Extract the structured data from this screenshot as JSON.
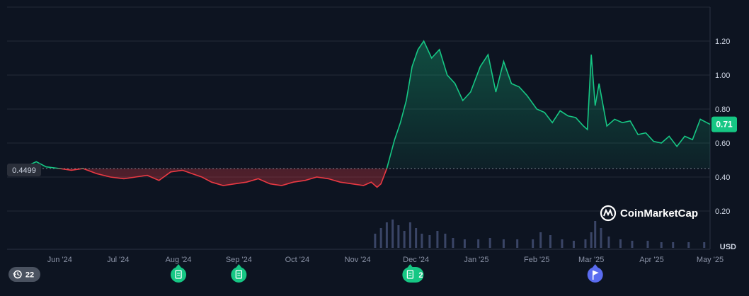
{
  "chart_data": {
    "type": "area",
    "baseline": 0.4499,
    "current_value": 0.71,
    "currency": "USD",
    "ylim": [
      0.0,
      1.38
    ],
    "y_ticks": [
      0.2,
      0.4,
      0.6,
      0.8,
      1.0,
      1.2
    ],
    "y_tick_labels": [
      "0.20",
      "0.40",
      "0.60",
      "0.80",
      "1.00",
      "1.20"
    ],
    "baseline_label": "0.4499",
    "current_label": "0.71",
    "x_ticks": [
      {
        "label": "Jun '24",
        "date": "2024-06-01"
      },
      {
        "label": "Jul '24",
        "date": "2024-07-01"
      },
      {
        "label": "Aug '24",
        "date": "2024-08-01"
      },
      {
        "label": "Sep '24",
        "date": "2024-09-01"
      },
      {
        "label": "Oct '24",
        "date": "2024-10-01"
      },
      {
        "label": "Nov '24",
        "date": "2024-11-01"
      },
      {
        "label": "Dec '24",
        "date": "2024-12-01"
      },
      {
        "label": "Jan '25",
        "date": "2025-01-01"
      },
      {
        "label": "Feb '25",
        "date": "2025-02-01"
      },
      {
        "label": "Mar '25",
        "date": "2025-03-01"
      },
      {
        "label": "Apr '25",
        "date": "2025-04-01"
      },
      {
        "label": "May '25",
        "date": "2025-05-01"
      }
    ],
    "x_range": [
      "2024-05-05",
      "2025-05-01"
    ],
    "series": [
      {
        "x": [
          "2024-05-05",
          "2024-05-12",
          "2024-05-16",
          "2024-05-20",
          "2024-05-25",
          "2024-06-01",
          "2024-06-07",
          "2024-06-13",
          "2024-06-20",
          "2024-06-27",
          "2024-07-04",
          "2024-07-10",
          "2024-07-16",
          "2024-07-22",
          "2024-07-28",
          "2024-08-03",
          "2024-08-08",
          "2024-08-13",
          "2024-08-18",
          "2024-08-24",
          "2024-08-30",
          "2024-09-05",
          "2024-09-11",
          "2024-09-17",
          "2024-09-23",
          "2024-09-29",
          "2024-10-05",
          "2024-10-11",
          "2024-10-17",
          "2024-10-23",
          "2024-10-29",
          "2024-11-04",
          "2024-11-08",
          "2024-11-11",
          "2024-11-13",
          "2024-11-16",
          "2024-11-20",
          "2024-11-23",
          "2024-11-26",
          "2024-11-29",
          "2024-12-02",
          "2024-12-05",
          "2024-12-09",
          "2024-12-13",
          "2024-12-17",
          "2024-12-21",
          "2024-12-25",
          "2024-12-29",
          "2025-01-03",
          "2025-01-07",
          "2025-01-11",
          "2025-01-15",
          "2025-01-19",
          "2025-01-23",
          "2025-01-27",
          "2025-02-01",
          "2025-02-05",
          "2025-02-09",
          "2025-02-13",
          "2025-02-17",
          "2025-02-21",
          "2025-02-25",
          "2025-02-27",
          "2025-03-01",
          "2025-03-03",
          "2025-03-05",
          "2025-03-09",
          "2025-03-13",
          "2025-03-17",
          "2025-03-21",
          "2025-03-25",
          "2025-03-29",
          "2025-04-02",
          "2025-04-06",
          "2025-04-10",
          "2025-04-14",
          "2025-04-18",
          "2025-04-22",
          "2025-04-26",
          "2025-05-01"
        ],
        "y": [
          0.45,
          0.46,
          0.47,
          0.49,
          0.46,
          0.45,
          0.44,
          0.45,
          0.42,
          0.4,
          0.39,
          0.4,
          0.41,
          0.38,
          0.43,
          0.44,
          0.42,
          0.4,
          0.37,
          0.35,
          0.36,
          0.37,
          0.39,
          0.36,
          0.35,
          0.37,
          0.38,
          0.4,
          0.39,
          0.37,
          0.36,
          0.35,
          0.37,
          0.34,
          0.36,
          0.45,
          0.62,
          0.72,
          0.85,
          1.05,
          1.15,
          1.2,
          1.1,
          1.15,
          1.0,
          0.95,
          0.85,
          0.9,
          1.05,
          1.12,
          0.9,
          1.08,
          0.95,
          0.93,
          0.88,
          0.8,
          0.78,
          0.72,
          0.79,
          0.76,
          0.75,
          0.7,
          0.68,
          1.12,
          0.82,
          0.95,
          0.7,
          0.74,
          0.72,
          0.73,
          0.65,
          0.66,
          0.61,
          0.6,
          0.64,
          0.58,
          0.64,
          0.62,
          0.74,
          0.71
        ]
      }
    ],
    "volume": {
      "x": [
        "2024-11-10",
        "2024-11-13",
        "2024-11-16",
        "2024-11-19",
        "2024-11-22",
        "2024-11-25",
        "2024-11-28",
        "2024-12-01",
        "2024-12-04",
        "2024-12-08",
        "2024-12-12",
        "2024-12-16",
        "2024-12-20",
        "2024-12-26",
        "2025-01-02",
        "2025-01-08",
        "2025-01-15",
        "2025-01-22",
        "2025-01-30",
        "2025-02-03",
        "2025-02-08",
        "2025-02-14",
        "2025-02-20",
        "2025-02-26",
        "2025-03-01",
        "2025-03-03",
        "2025-03-06",
        "2025-03-10",
        "2025-03-16",
        "2025-03-22",
        "2025-03-30",
        "2025-04-06",
        "2025-04-12",
        "2025-04-20",
        "2025-04-28"
      ],
      "values": [
        0.5,
        0.7,
        0.9,
        1.0,
        0.8,
        0.6,
        0.9,
        0.7,
        0.5,
        0.45,
        0.6,
        0.5,
        0.35,
        0.3,
        0.3,
        0.35,
        0.3,
        0.3,
        0.3,
        0.55,
        0.45,
        0.3,
        0.25,
        0.3,
        0.55,
        0.95,
        0.7,
        0.4,
        0.3,
        0.25,
        0.25,
        0.2,
        0.2,
        0.2,
        0.2
      ]
    },
    "event_badges": [
      {
        "date": "2024-08-01",
        "type": "document"
      },
      {
        "date": "2024-09-01",
        "type": "document"
      },
      {
        "date": "2024-11-28",
        "type": "document",
        "count": "2"
      },
      {
        "date": "2025-03-03",
        "type": "flag"
      }
    ],
    "history_count": "22",
    "brand": "CoinMarketCap",
    "colors": {
      "up": "#16c784",
      "down": "#ea3943",
      "up_label_bg": "#16c784",
      "baseline_label_bg": "#2a2f3a",
      "flag_badge_bg": "#5a6cf0",
      "badge_bg": "#16c784",
      "grid": "#222a38",
      "volume": "#3a4566"
    },
    "grid": true
  }
}
